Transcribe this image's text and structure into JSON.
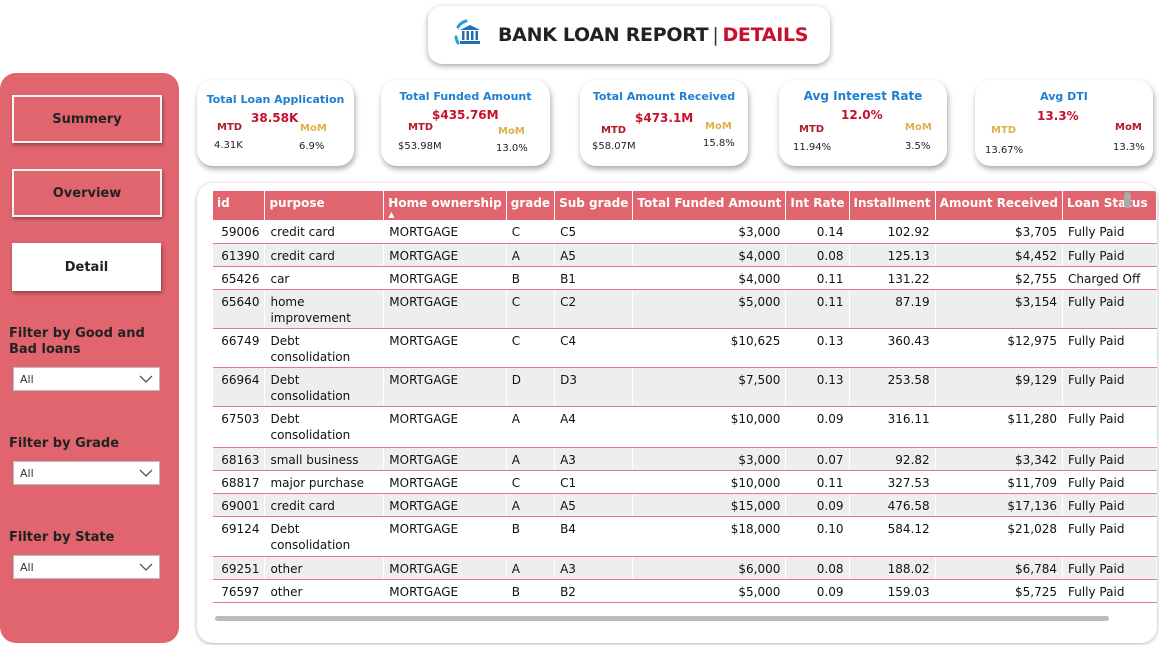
{
  "header": {
    "title_main": "BANK LOAN REPORT",
    "title_sep": "|",
    "title_accent": "DETAILS",
    "icon": "bank-icon"
  },
  "sidebar": {
    "nav": [
      "Summery",
      "Overview",
      "Detail"
    ],
    "active": "Detail",
    "filters": [
      {
        "label": "Filter by Good and Bad loans",
        "value": "All"
      },
      {
        "label": "Filter by Grade",
        "value": "All"
      },
      {
        "label": "Filter by State",
        "value": "All"
      }
    ]
  },
  "kpis": [
    {
      "title": "Total Loan Application",
      "value": "38.58K",
      "mtd_label": "MTD",
      "mtd": "4.31K",
      "mom_label": "MoM",
      "mom": "6.9%"
    },
    {
      "title": "Total Funded Amount",
      "value": "$435.76M",
      "mtd_label": "MTD",
      "mtd": "$53.98M",
      "mom_label": "MoM",
      "mom": "13.0%"
    },
    {
      "title": "Total Amount Received",
      "value": "$473.1M",
      "mtd_label": "MTD",
      "mtd": "$58.07M",
      "mom_label": "MoM",
      "mom": "15.8%"
    },
    {
      "title": "Avg Interest Rate",
      "value": "12.0%",
      "mtd_label": "MTD",
      "mtd": "11.94%",
      "mom_label": "MoM",
      "mom": "3.5%"
    },
    {
      "title": "Avg DTI",
      "value": "13.3%",
      "mtd_label": "MTD",
      "mtd": "13.67%",
      "mom_label": "MoM",
      "mom": "13.3%"
    }
  ],
  "table": {
    "columns": [
      "id",
      "purpose",
      "Home ownership",
      "grade",
      "Sub grade",
      "Total Funded Amount",
      "Int Rate",
      "Installment",
      "Amount Received",
      "Loan Status"
    ],
    "sort_indicator": "▲",
    "rows": [
      [
        "59006",
        "credit card",
        "MORTGAGE",
        "C",
        "C5",
        "$3,000",
        "0.14",
        "102.92",
        "$3,705",
        "Fully Paid"
      ],
      [
        "61390",
        "credit card",
        "MORTGAGE",
        "A",
        "A5",
        "$4,000",
        "0.08",
        "125.13",
        "$4,452",
        "Fully Paid"
      ],
      [
        "65426",
        "car",
        "MORTGAGE",
        "B",
        "B1",
        "$4,000",
        "0.11",
        "131.22",
        "$2,755",
        "Charged Off"
      ],
      [
        "65640",
        "home improvement",
        "MORTGAGE",
        "C",
        "C2",
        "$5,000",
        "0.11",
        "87.19",
        "$3,154",
        "Fully Paid"
      ],
      [
        "66749",
        "Debt consolidation",
        "MORTGAGE",
        "C",
        "C4",
        "$10,625",
        "0.13",
        "360.43",
        "$12,975",
        "Fully Paid"
      ],
      [
        "66964",
        "Debt consolidation",
        "MORTGAGE",
        "D",
        "D3",
        "$7,500",
        "0.13",
        "253.58",
        "$9,129",
        "Fully Paid"
      ],
      [
        "67503",
        "Debt consolidation",
        "MORTGAGE",
        "A",
        "A4",
        "$10,000",
        "0.09",
        "316.11",
        "$11,280",
        "Fully Paid"
      ],
      [
        "68163",
        "small business",
        "MORTGAGE",
        "A",
        "A3",
        "$3,000",
        "0.07",
        "92.82",
        "$3,342",
        "Fully Paid"
      ],
      [
        "68817",
        "major purchase",
        "MORTGAGE",
        "C",
        "C1",
        "$10,000",
        "0.11",
        "327.53",
        "$11,709",
        "Fully Paid"
      ],
      [
        "69001",
        "credit card",
        "MORTGAGE",
        "A",
        "A5",
        "$15,000",
        "0.09",
        "476.58",
        "$17,136",
        "Fully Paid"
      ],
      [
        "69124",
        "Debt consolidation",
        "MORTGAGE",
        "B",
        "B4",
        "$18,000",
        "0.10",
        "584.12",
        "$21,028",
        "Fully Paid"
      ],
      [
        "69251",
        "other",
        "MORTGAGE",
        "A",
        "A3",
        "$6,000",
        "0.08",
        "188.02",
        "$6,784",
        "Fully Paid"
      ],
      [
        "76597",
        "other",
        "MORTGAGE",
        "B",
        "B2",
        "$5,000",
        "0.09",
        "159.03",
        "$5,725",
        "Fully Paid"
      ]
    ]
  },
  "colors": {
    "accent": "#e0656f",
    "title_accent": "#c8102e",
    "kpi_title": "#1f7fd1",
    "mom_label": "#e0b048"
  }
}
